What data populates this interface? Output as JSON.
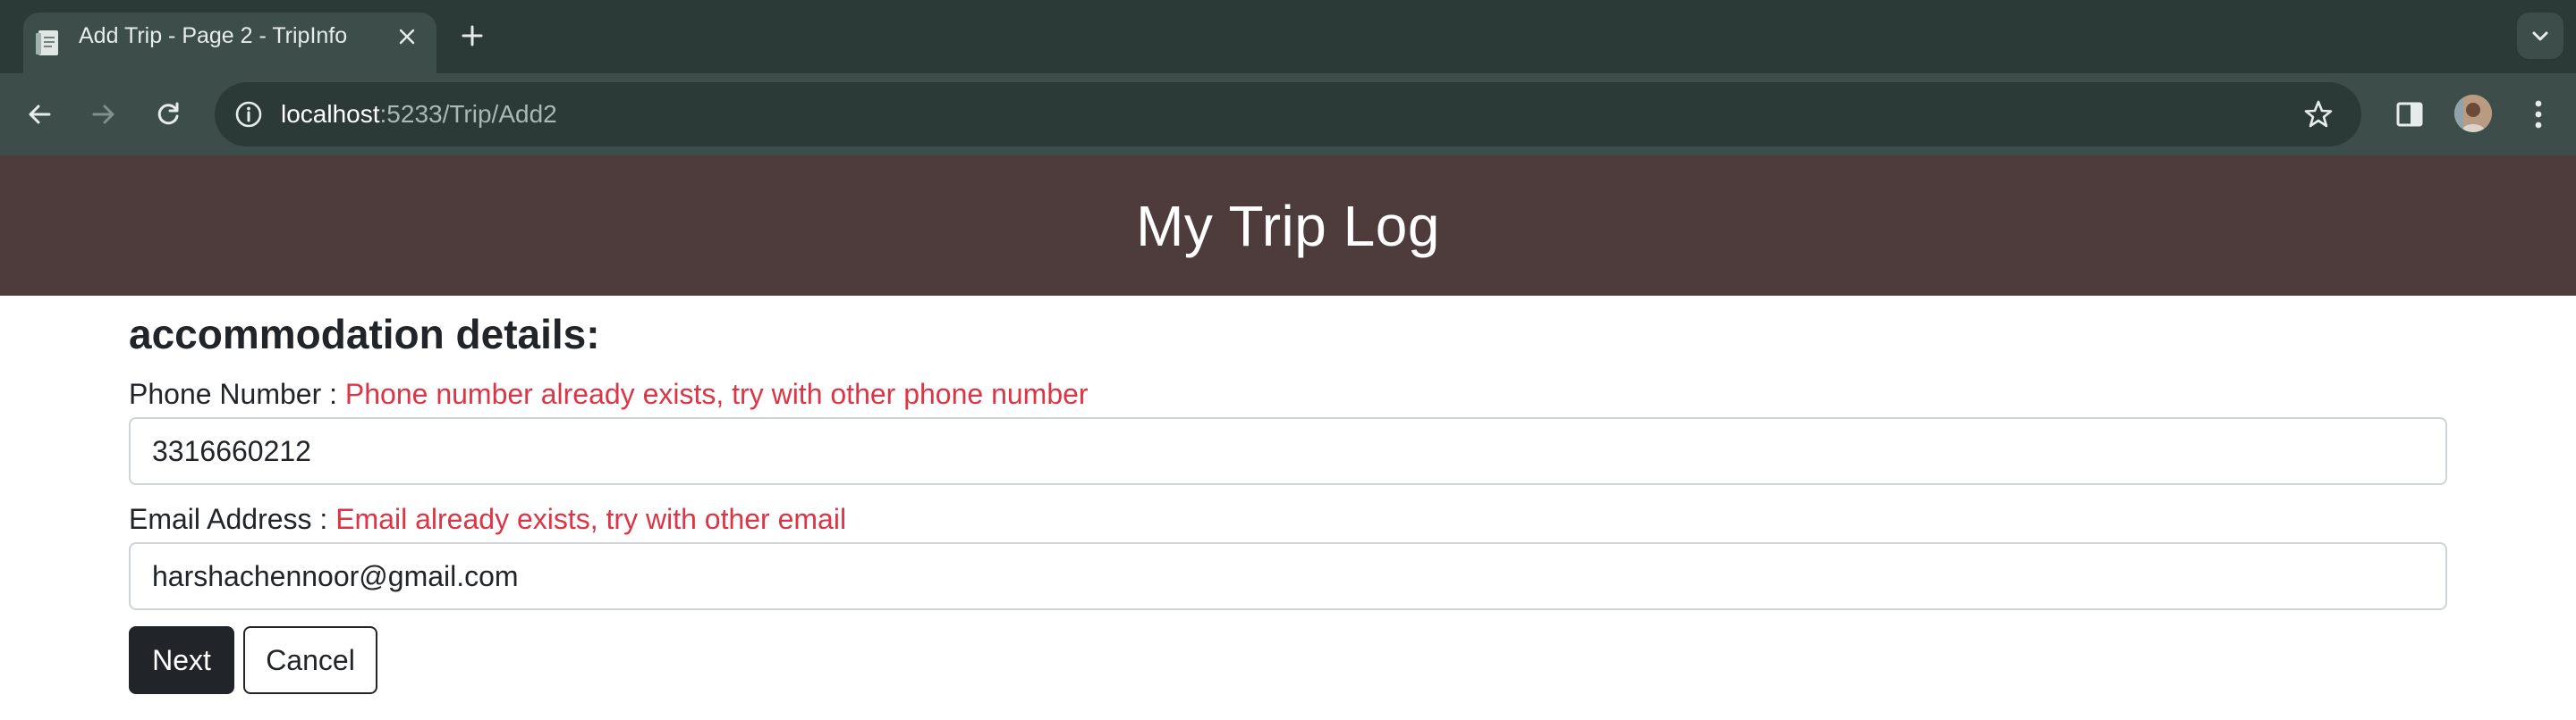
{
  "browser": {
    "tab": {
      "title": "Add Trip - Page 2 - TripInfo",
      "favicon": "document-icon"
    },
    "address_bar": {
      "host": "localhost",
      "path": ":5233/Trip/Add2"
    },
    "icons": {
      "back": "arrow-left-icon",
      "forward": "arrow-right-icon",
      "reload": "reload-icon",
      "info": "info-icon",
      "bookmark": "star-icon",
      "side_panel": "side-panel-icon",
      "profile": "avatar",
      "menu": "kebab-menu-icon",
      "new_tab": "plus-icon",
      "tab_search": "chevron-down-icon"
    },
    "colors": {
      "tabstrip": "#2c3a37",
      "toolbar": "#3d4d49"
    }
  },
  "page": {
    "header": {
      "title": "My Trip Log",
      "background": "#4e3c3c"
    },
    "section_heading": "accommodation details:",
    "phone": {
      "label": "Phone Number :",
      "error": "Phone number already exists, try with other phone number",
      "value": "3316660212"
    },
    "email": {
      "label": "Email Address :",
      "error": "Email already exists, try with other email",
      "value": "harshachennoor@gmail.com"
    },
    "buttons": {
      "next": "Next",
      "cancel": "Cancel"
    },
    "colors": {
      "error": "#dc3545",
      "primary_button": "#212529"
    }
  }
}
